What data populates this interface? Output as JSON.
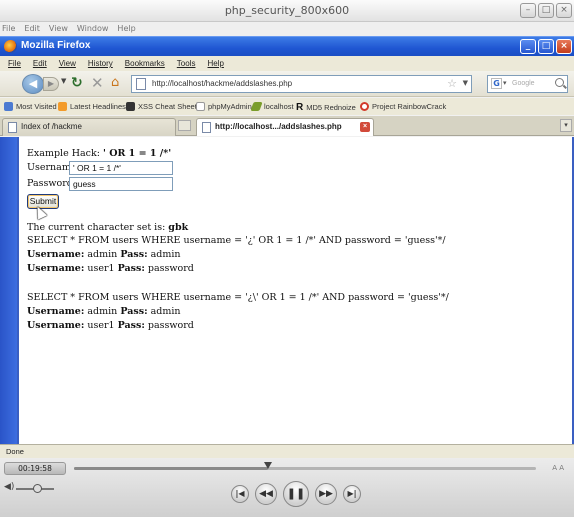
{
  "vm": {
    "window_title": "php_security_800x600",
    "menu": [
      "File",
      "Edit",
      "View",
      "Window",
      "Help"
    ]
  },
  "firefox": {
    "title": "Mozilla Firefox",
    "menu": [
      "File",
      "Edit",
      "View",
      "History",
      "Bookmarks",
      "Tools",
      "Help"
    ],
    "url": "http://localhost/hackme/addslashes.php",
    "search_placeholder": "Google",
    "bookmarks": [
      "Most Visited",
      "Latest Headlines",
      "XSS Cheat Sheet",
      "phpMyAdmin",
      "localhost",
      "MD5 Rednoize",
      "Project RainbowCrack"
    ],
    "tabs": [
      "Index of /hackme",
      "http://localhost.../addslashes.php"
    ],
    "status": "Done"
  },
  "page": {
    "example_prefix": "Example Hack: ",
    "example_value": "' OR 1 = 1 /*'",
    "username_label": "Username:",
    "username_value": "' OR 1 = 1 /*'",
    "password_label": "Password:",
    "password_value": "guess",
    "submit_label": "Submit",
    "charset_prefix": "The current character set is: ",
    "charset_value": "gbk",
    "query1": "SELECT * FROM users WHERE username = '¿' OR 1 = 1 /*' AND password = 'guess'*/",
    "query2": "SELECT * FROM users WHERE username = '¿\\' OR 1 = 1 /*' AND password = 'guess'*/",
    "username_key": "Username:",
    "pass_key": "Pass:",
    "results1": [
      {
        "user": "admin",
        "pass": "admin"
      },
      {
        "user": "user1",
        "pass": "password"
      }
    ],
    "results2": [
      {
        "user": "admin",
        "pass": "admin"
      },
      {
        "user": "user1",
        "pass": "password"
      }
    ]
  },
  "player": {
    "time": "00:19:58",
    "progress": 0.42,
    "aa": "A A"
  }
}
